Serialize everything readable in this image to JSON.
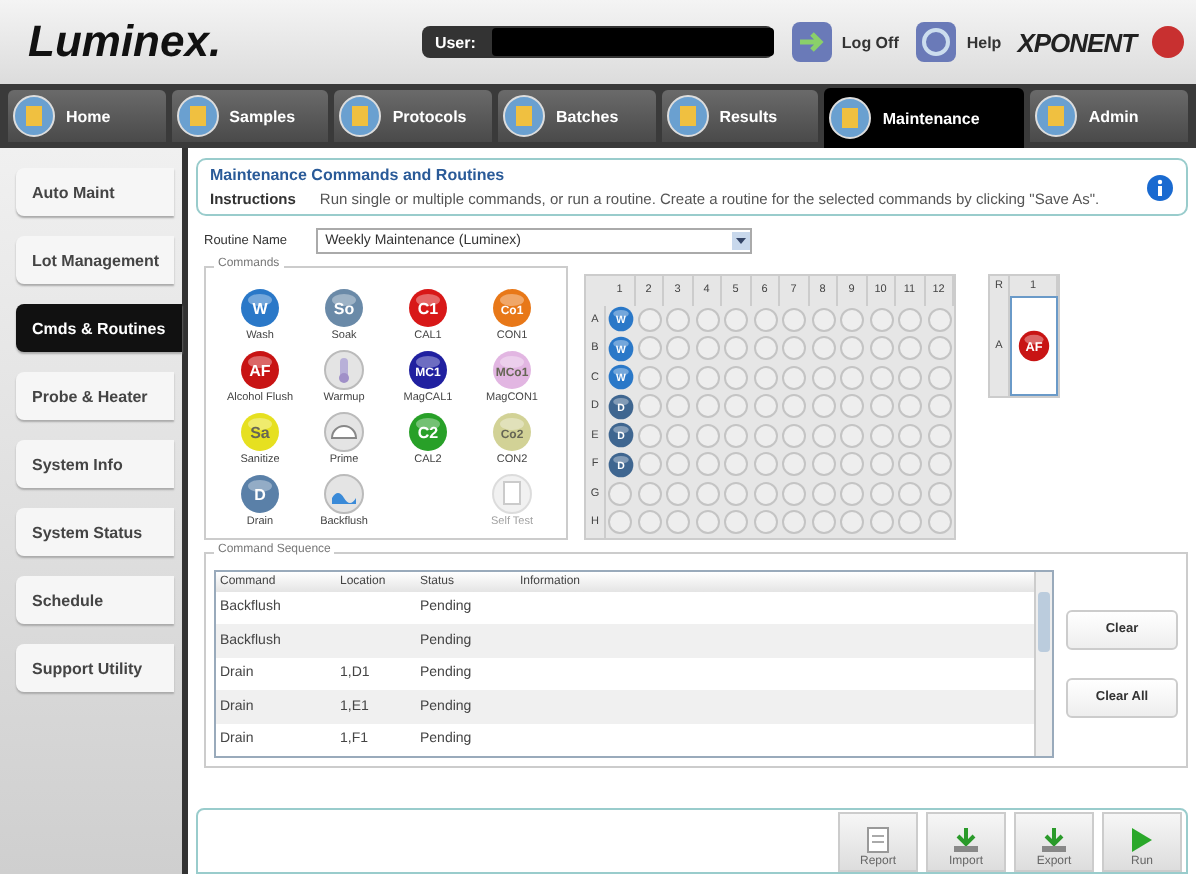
{
  "header": {
    "logo": "Luminex.",
    "user_label": "User:",
    "log_off": "Log Off",
    "help": "Help",
    "product_logo": "XPONENT"
  },
  "nav_tabs": [
    {
      "label": "Home",
      "selected": false
    },
    {
      "label": "Samples",
      "selected": false
    },
    {
      "label": "Protocols",
      "selected": false
    },
    {
      "label": "Batches",
      "selected": false
    },
    {
      "label": "Results",
      "selected": false
    },
    {
      "label": "Maintenance",
      "selected": true
    },
    {
      "label": "Admin",
      "selected": false
    }
  ],
  "sidebar": {
    "items": [
      {
        "label": "Auto Maint",
        "selected": false
      },
      {
        "label": "Lot Management",
        "selected": false
      },
      {
        "label": "Cmds & Routines",
        "selected": true
      },
      {
        "label": "Probe & Heater",
        "selected": false
      },
      {
        "label": "System Info",
        "selected": false
      },
      {
        "label": "System Status",
        "selected": false
      },
      {
        "label": "Schedule",
        "selected": false
      },
      {
        "label": "Support Utility",
        "selected": false
      }
    ]
  },
  "page": {
    "title": "Maintenance Commands and Routines",
    "instructions_label": "Instructions",
    "instructions": "Run single or multiple commands, or run a routine. Create a routine for the selected commands by clicking \"Save As\"."
  },
  "routine": {
    "label": "Routine Name",
    "value": "Weekly Maintenance (Luminex)"
  },
  "commands": {
    "title": "Commands",
    "items": [
      {
        "kind": "badge",
        "badge": "W",
        "label": "Wash",
        "color": "#2a78c8",
        "disabled": false
      },
      {
        "kind": "badge",
        "badge": "So",
        "label": "Soak",
        "color": "#6a8aa8",
        "disabled": false
      },
      {
        "kind": "badge",
        "badge": "C1",
        "label": "CAL1",
        "color": "#d81818",
        "disabled": false
      },
      {
        "kind": "badge",
        "badge": "Co1",
        "label": "CON1",
        "color": "#e87818",
        "disabled": false
      },
      {
        "kind": "badge",
        "badge": "AF",
        "label": "Alcohol Flush",
        "color": "#c81414",
        "disabled": false
      },
      {
        "kind": "warmup",
        "label": "Warmup",
        "disabled": false
      },
      {
        "kind": "badge",
        "badge": "MC1",
        "label": "MagCAL1",
        "color": "#2020a0",
        "disabled": false
      },
      {
        "kind": "badge",
        "badge": "MCo1",
        "label": "MagCON1",
        "color": "#e2b6e2",
        "disabled": false
      },
      {
        "kind": "badge",
        "badge": "Sa",
        "label": "Sanitize",
        "color": "#e6e020",
        "disabled": false
      },
      {
        "kind": "prime",
        "label": "Prime",
        "disabled": false
      },
      {
        "kind": "badge",
        "badge": "C2",
        "label": "CAL2",
        "color": "#28a028",
        "disabled": false
      },
      {
        "kind": "badge",
        "badge": "Co2",
        "label": "CON2",
        "color": "#d2d296",
        "disabled": false
      },
      {
        "kind": "badge",
        "badge": "D",
        "label": "Drain",
        "color": "#5a80a8",
        "disabled": false
      },
      {
        "kind": "backflush",
        "label": "Backflush",
        "disabled": false
      },
      {
        "kind": "empty"
      },
      {
        "kind": "selftest",
        "label": "Self Test",
        "disabled": true
      }
    ]
  },
  "plate": {
    "columns": [
      "1",
      "2",
      "3",
      "4",
      "5",
      "6",
      "7",
      "8",
      "9",
      "10",
      "11",
      "12"
    ],
    "rows": [
      {
        "label": "A",
        "first_well": {
          "label": "W",
          "color": "#2a78c8"
        }
      },
      {
        "label": "B",
        "first_well": {
          "label": "W",
          "color": "#2a78c8"
        }
      },
      {
        "label": "C",
        "first_well": {
          "label": "W",
          "color": "#2a78c8"
        }
      },
      {
        "label": "D",
        "first_well": {
          "label": "D",
          "color": "#3f6690"
        }
      },
      {
        "label": "E",
        "first_well": {
          "label": "D",
          "color": "#3f6690"
        }
      },
      {
        "label": "F",
        "first_well": {
          "label": "D",
          "color": "#3f6690"
        }
      },
      {
        "label": "G"
      },
      {
        "label": "H"
      }
    ]
  },
  "reservoir": {
    "corner": "R",
    "column": "1",
    "row": "A",
    "well": {
      "label": "AF",
      "color": "#c81414"
    }
  },
  "sequence": {
    "title": "Command Sequence",
    "columns": [
      "Command",
      "Location",
      "Status",
      "Information"
    ],
    "rows": [
      {
        "command": "Backflush",
        "status": "Pending"
      },
      {
        "command": "Backflush",
        "status": "Pending"
      },
      {
        "command": "Drain",
        "location": "1,D1",
        "status": "Pending"
      },
      {
        "command": "Drain",
        "location": "1,E1",
        "status": "Pending"
      },
      {
        "command": "Drain",
        "location": "1,F1",
        "status": "Pending"
      }
    ],
    "buttons": [
      "Clear",
      "Clear All"
    ]
  },
  "toolbar": [
    {
      "kind": "report",
      "label": "Report"
    },
    {
      "kind": "import",
      "label": "Import"
    },
    {
      "kind": "export",
      "label": "Export"
    },
    {
      "kind": "run",
      "label": "Run"
    }
  ]
}
